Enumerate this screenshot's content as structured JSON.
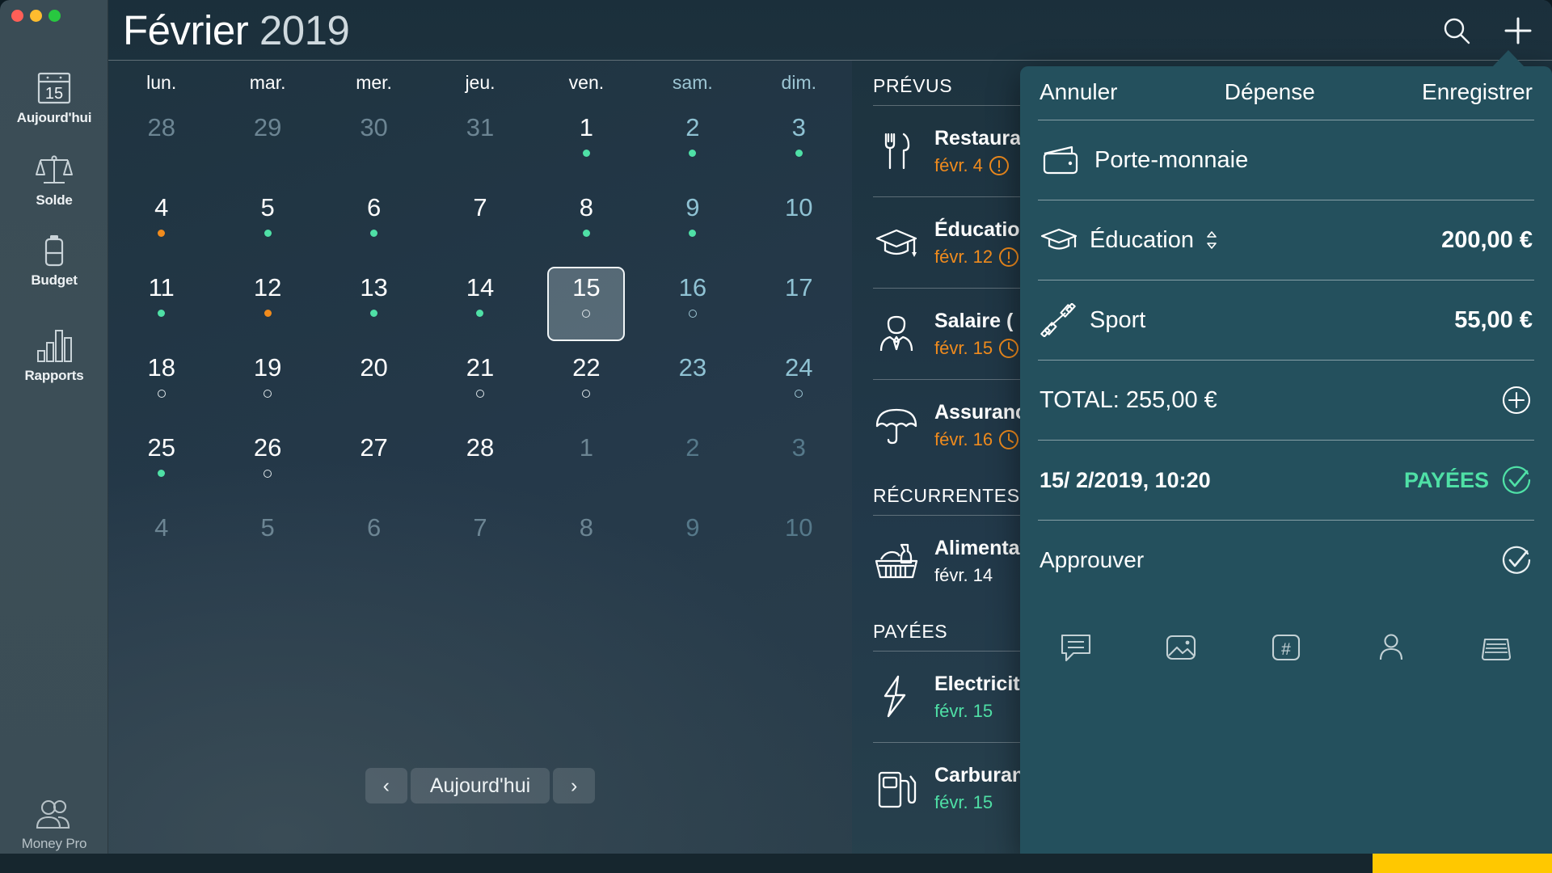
{
  "window": {
    "traffic_lights": [
      "close",
      "minimize",
      "zoom"
    ],
    "title_month": "Février",
    "title_year": "2019"
  },
  "sidebar": {
    "items": [
      {
        "label": "Aujourd'hui",
        "icon": "calendar-15-icon",
        "badge": "15"
      },
      {
        "label": "Solde",
        "icon": "balance-scale-icon"
      },
      {
        "label": "Budget",
        "icon": "battery-icon"
      },
      {
        "label": "Rapports",
        "icon": "bar-chart-icon"
      }
    ],
    "footer": {
      "label": "Money Pro",
      "icon": "users-icon"
    }
  },
  "header": {
    "search_icon": "search-icon",
    "add_icon": "plus-icon"
  },
  "calendar": {
    "weekdays": [
      {
        "short": "lun.",
        "weekend": false
      },
      {
        "short": "mar.",
        "weekend": false
      },
      {
        "short": "mer.",
        "weekend": false
      },
      {
        "short": "jeu.",
        "weekend": false
      },
      {
        "short": "ven.",
        "weekend": false
      },
      {
        "short": "sam.",
        "weekend": true
      },
      {
        "short": "dim.",
        "weekend": true
      }
    ],
    "days": [
      {
        "n": "28",
        "out": true,
        "we": false,
        "mark": "none"
      },
      {
        "n": "29",
        "out": true,
        "we": false,
        "mark": "none"
      },
      {
        "n": "30",
        "out": true,
        "we": false,
        "mark": "none"
      },
      {
        "n": "31",
        "out": true,
        "we": false,
        "mark": "none"
      },
      {
        "n": "1",
        "out": false,
        "we": false,
        "mark": "green"
      },
      {
        "n": "2",
        "out": false,
        "we": true,
        "mark": "green"
      },
      {
        "n": "3",
        "out": false,
        "we": true,
        "mark": "green"
      },
      {
        "n": "4",
        "out": false,
        "we": false,
        "mark": "orange"
      },
      {
        "n": "5",
        "out": false,
        "we": false,
        "mark": "green"
      },
      {
        "n": "6",
        "out": false,
        "we": false,
        "mark": "green"
      },
      {
        "n": "7",
        "out": false,
        "we": false,
        "mark": "none"
      },
      {
        "n": "8",
        "out": false,
        "we": false,
        "mark": "green"
      },
      {
        "n": "9",
        "out": false,
        "we": true,
        "mark": "green"
      },
      {
        "n": "10",
        "out": false,
        "we": true,
        "mark": "none"
      },
      {
        "n": "11",
        "out": false,
        "we": false,
        "mark": "green"
      },
      {
        "n": "12",
        "out": false,
        "we": false,
        "mark": "orange"
      },
      {
        "n": "13",
        "out": false,
        "we": false,
        "mark": "green"
      },
      {
        "n": "14",
        "out": false,
        "we": false,
        "mark": "green"
      },
      {
        "n": "15",
        "out": false,
        "we": false,
        "mark": "ring",
        "selected": true
      },
      {
        "n": "16",
        "out": false,
        "we": true,
        "mark": "ring"
      },
      {
        "n": "17",
        "out": false,
        "we": true,
        "mark": "none"
      },
      {
        "n": "18",
        "out": false,
        "we": false,
        "mark": "ring"
      },
      {
        "n": "19",
        "out": false,
        "we": false,
        "mark": "ring"
      },
      {
        "n": "20",
        "out": false,
        "we": false,
        "mark": "none"
      },
      {
        "n": "21",
        "out": false,
        "we": false,
        "mark": "ring"
      },
      {
        "n": "22",
        "out": false,
        "we": false,
        "mark": "ring"
      },
      {
        "n": "23",
        "out": false,
        "we": true,
        "mark": "none"
      },
      {
        "n": "24",
        "out": false,
        "we": true,
        "mark": "ring"
      },
      {
        "n": "25",
        "out": false,
        "we": false,
        "mark": "green"
      },
      {
        "n": "26",
        "out": false,
        "we": false,
        "mark": "ring"
      },
      {
        "n": "27",
        "out": false,
        "we": false,
        "mark": "none"
      },
      {
        "n": "28",
        "out": false,
        "we": false,
        "mark": "none"
      },
      {
        "n": "1",
        "out": true,
        "we": false,
        "mark": "none"
      },
      {
        "n": "2",
        "out": true,
        "we": true,
        "mark": "none"
      },
      {
        "n": "3",
        "out": true,
        "we": true,
        "mark": "none"
      },
      {
        "n": "4",
        "out": true,
        "we": false,
        "mark": "none"
      },
      {
        "n": "5",
        "out": true,
        "we": false,
        "mark": "none"
      },
      {
        "n": "6",
        "out": true,
        "we": false,
        "mark": "none"
      },
      {
        "n": "7",
        "out": true,
        "we": false,
        "mark": "none"
      },
      {
        "n": "8",
        "out": true,
        "we": false,
        "mark": "none"
      },
      {
        "n": "9",
        "out": true,
        "we": true,
        "mark": "none"
      },
      {
        "n": "10",
        "out": true,
        "we": true,
        "mark": "none"
      }
    ],
    "nav": {
      "prev": "‹",
      "today": "Aujourd'hui",
      "next": "›"
    }
  },
  "transactions": {
    "sections": [
      {
        "title": "PRÉVUS",
        "items": [
          {
            "name": "Restaurant",
            "date": "févr. 4",
            "status": "overdue",
            "status_icon": "exclamation-circle-icon",
            "icon": "cutlery-icon"
          },
          {
            "name": "Éducation",
            "date": "févr. 12",
            "status": "overdue",
            "status_icon": "exclamation-circle-icon",
            "icon": "graduation-cap-icon"
          },
          {
            "name": "Salaire (",
            "date": "févr. 15",
            "status": "pending",
            "status_icon": "clock-icon",
            "icon": "person-tie-icon"
          },
          {
            "name": "Assurance",
            "date": "févr. 16",
            "status": "pending",
            "status_icon": "clock-icon",
            "icon": "umbrella-icon"
          }
        ]
      },
      {
        "title": "RÉCURRENTES",
        "items": [
          {
            "name": "Alimentation",
            "date": "févr. 14",
            "status": "plain",
            "status_icon": "",
            "icon": "basket-icon"
          }
        ]
      },
      {
        "title": "PAYÉES",
        "items": [
          {
            "name": "Electricité",
            "date": "févr. 15",
            "status": "paid",
            "status_icon": "",
            "icon": "bolt-icon"
          },
          {
            "name": "Carburant",
            "date": "févr. 15",
            "status": "paid",
            "status_icon": "",
            "icon": "fuel-pump-icon"
          }
        ]
      }
    ]
  },
  "popover": {
    "cancel_label": "Annuler",
    "title": "Dépense",
    "save_label": "Enregistrer",
    "account": {
      "name": "Porte-monnaie",
      "icon": "wallet-icon"
    },
    "lines": [
      {
        "name": "Éducation",
        "amount": "200,00 €",
        "icon": "graduation-cap-icon",
        "has_stepper": true,
        "stepper_icon": "chevron-updown-icon"
      },
      {
        "name": "Sport",
        "amount": "55,00 €",
        "icon": "dumbbell-icon",
        "has_stepper": false
      }
    ],
    "total_label": "TOTAL: 255,00 €",
    "add_line_icon": "plus-circle-icon",
    "datetime": "15/  2/2019, 10:20",
    "paid_label": "PAYÉES",
    "paid_icon": "check-circle-icon",
    "approve_label": "Approuver",
    "approve_icon": "check-circle-icon",
    "tool_icons": [
      "comment-icon",
      "photo-icon",
      "hashtag-icon",
      "contact-icon",
      "drawer-icon"
    ]
  },
  "colors": {
    "accent_green": "#4fe0a6",
    "accent_orange": "#f08b1d",
    "popover_bg": "#24505c",
    "sidebar_bg": "#3b4d56",
    "calendar_bg": "#22394a",
    "yellow_strip": "#ffc800"
  }
}
